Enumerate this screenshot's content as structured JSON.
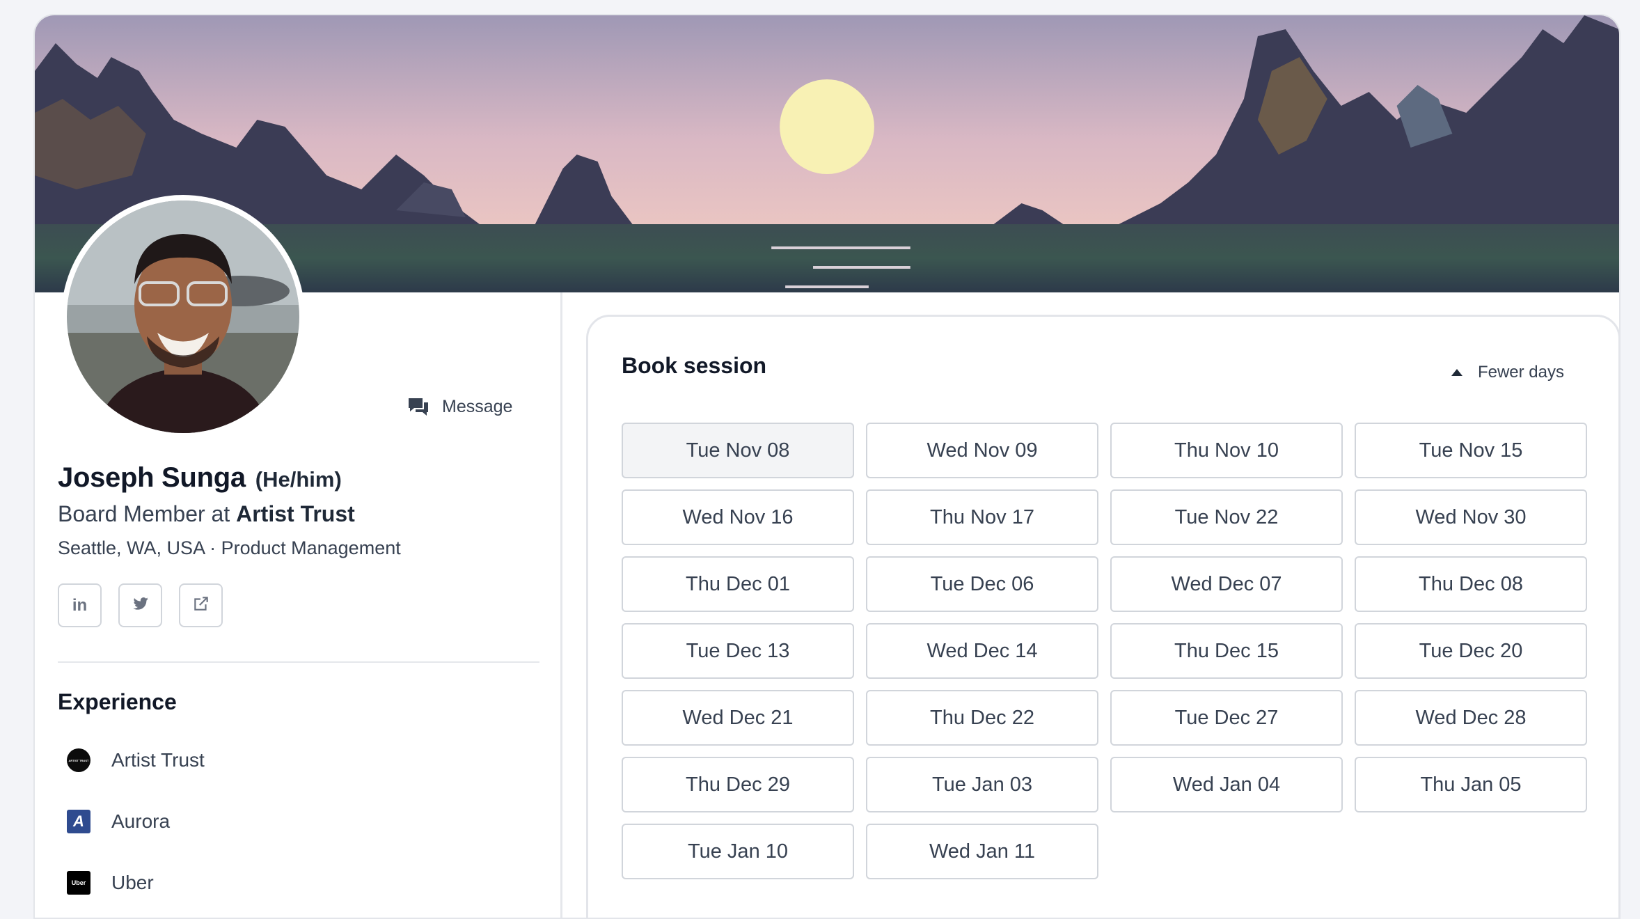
{
  "profile": {
    "name": "Joseph Sunga",
    "pronouns": "(He/him)",
    "role_prefix": "Board Member at ",
    "organization": "Artist Trust",
    "meta": "Seattle, WA, USA · Product Management",
    "message_label": "Message"
  },
  "socials": [
    {
      "icon": "linkedin-icon",
      "label": "in"
    },
    {
      "icon": "twitter-icon"
    },
    {
      "icon": "external-link-icon"
    }
  ],
  "experience": {
    "title": "Experience",
    "items": [
      {
        "name": "Artist Trust",
        "logo": "artist-trust-logo",
        "logo_text": "ARTIST TRUST"
      },
      {
        "name": "Aurora",
        "logo": "aurora-logo",
        "logo_text": "A"
      },
      {
        "name": "Uber",
        "logo": "uber-logo",
        "logo_text": "Uber"
      }
    ]
  },
  "booking": {
    "title": "Book session",
    "toggle_label": "Fewer days",
    "selected_index": 0,
    "dates": [
      "Tue Nov 08",
      "Wed Nov 09",
      "Thu Nov 10",
      "Tue Nov 15",
      "Wed Nov 16",
      "Thu Nov 17",
      "Tue Nov 22",
      "Wed Nov 30",
      "Thu Dec 01",
      "Tue Dec 06",
      "Wed Dec 07",
      "Thu Dec 08",
      "Tue Dec 13",
      "Wed Dec 14",
      "Thu Dec 15",
      "Tue Dec 20",
      "Wed Dec 21",
      "Thu Dec 22",
      "Tue Dec 27",
      "Wed Dec 28",
      "Thu Dec 29",
      "Tue Jan 03",
      "Wed Jan 04",
      "Thu Jan 05",
      "Tue Jan 10",
      "Wed Jan 11"
    ]
  },
  "colors": {
    "sky_top": "#a99fb9",
    "sky_bottom": "#e8c3c1",
    "sun": "#f8f1b4",
    "rocks": "#3b3c55",
    "ground": "#3a4a4a"
  }
}
